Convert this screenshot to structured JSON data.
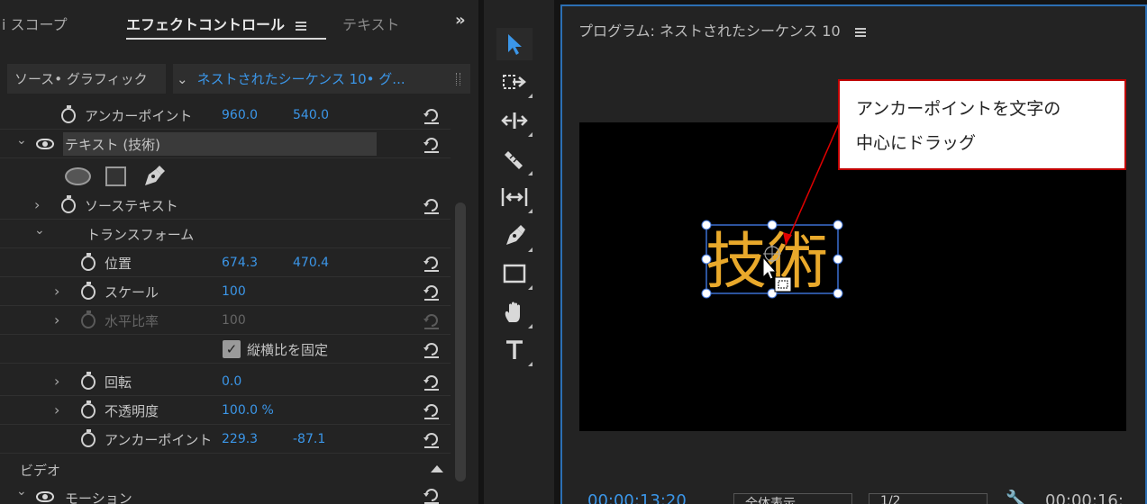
{
  "left_panel": {
    "tabs": {
      "scope": "i スコープ",
      "effect_controls": "エフェクトコントロール",
      "text": "テキスト"
    },
    "source": {
      "label": "ソース• グラフィック",
      "sequence": "ネストされたシーケンス 10• グ..."
    },
    "properties": {
      "anchor_top": {
        "label": "アンカーポイント",
        "x": "960.0",
        "y": "540.0"
      },
      "text_layer": {
        "label": "テキスト (技術)"
      },
      "source_text": {
        "label": "ソーステキスト"
      },
      "transform": {
        "label": "トランスフォーム"
      },
      "position": {
        "label": "位置",
        "x": "674.3",
        "y": "470.4"
      },
      "scale": {
        "label": "スケール",
        "value": "100"
      },
      "scale_width": {
        "label": "水平比率",
        "value": "100"
      },
      "uniform_scale": {
        "label": "縦横比を固定"
      },
      "rotation": {
        "label": "回転",
        "value": "0.0"
      },
      "opacity": {
        "label": "不透明度",
        "value": "100.0 %"
      },
      "anchor": {
        "label": "アンカーポイント",
        "x": "229.3",
        "y": "-87.1"
      }
    },
    "video_section": "ビデオ",
    "motion_label": "モーション"
  },
  "program": {
    "title": "プログラム: ネストされたシーケンス 10",
    "clip_text": "技術",
    "timecode": "00:00:13:20",
    "fit": "全体表示",
    "resolution": "1/2",
    "duration": "00:00:16:"
  },
  "callout": {
    "line1": "アンカーポイントを文字の",
    "line2": "中心にドラッグ"
  },
  "colors": {
    "accent_blue": "#3b96e8",
    "text_gold": "#e9a92b",
    "callout_border": "#c00000",
    "monitor_border": "#2c6fb4"
  }
}
